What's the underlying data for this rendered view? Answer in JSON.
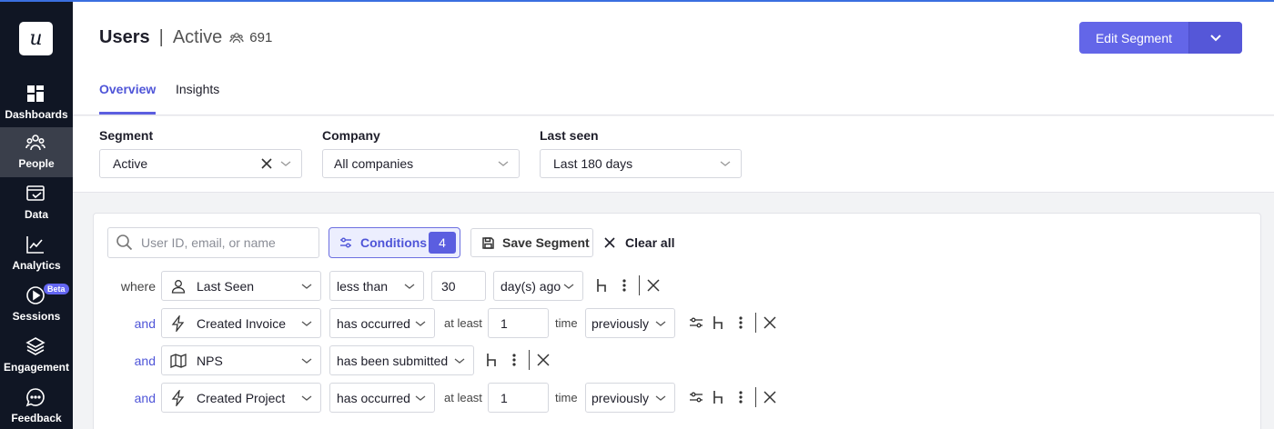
{
  "sidebar": {
    "logo": "u",
    "items": [
      {
        "label": "Dashboards",
        "icon": "dashboard-icon"
      },
      {
        "label": "People",
        "icon": "people-icon",
        "active": true
      },
      {
        "label": "Data",
        "icon": "data-icon"
      },
      {
        "label": "Analytics",
        "icon": "analytics-icon"
      },
      {
        "label": "Sessions",
        "icon": "sessions-icon",
        "badge": "Beta"
      },
      {
        "label": "Engagement",
        "icon": "engagement-icon"
      },
      {
        "label": "Feedback",
        "icon": "feedback-icon"
      }
    ]
  },
  "header": {
    "title": "Users",
    "separator": "|",
    "segment": "Active",
    "count": "691",
    "edit_button": "Edit Segment",
    "tabs": [
      {
        "label": "Overview",
        "active": true
      },
      {
        "label": "Insights",
        "active": false
      }
    ]
  },
  "filters": [
    {
      "label": "Segment",
      "value": "Active",
      "clearable": true
    },
    {
      "label": "Company",
      "value": "All companies"
    },
    {
      "label": "Last seen",
      "value": "Last 180 days"
    }
  ],
  "toolbar": {
    "search_placeholder": "User ID, email, or name",
    "conditions_label": "Conditions",
    "conditions_count": "4",
    "save_label": "Save Segment",
    "clear_label": "Clear all"
  },
  "conditions": [
    {
      "conj": "where",
      "field": "Last Seen",
      "field_icon": "user-icon",
      "operator": "less than",
      "value": "30",
      "unit": "day(s) ago"
    },
    {
      "conj": "and",
      "field": "Created Invoice",
      "field_icon": "lightning-icon",
      "operator": "has occurred",
      "mid": "at least",
      "value": "1",
      "unit_label": "time",
      "timeframe": "previously"
    },
    {
      "conj": "and",
      "field": "NPS",
      "field_icon": "map-icon",
      "operator": "has been submitted"
    },
    {
      "conj": "and",
      "field": "Created Project",
      "field_icon": "lightning-icon",
      "operator": "has occurred",
      "mid": "at least",
      "value": "1",
      "unit_label": "time",
      "timeframe": "previously"
    }
  ],
  "colors": {
    "sidebar_bg": "#101624",
    "accent": "#6366e8",
    "active_tab": "#4f55d8"
  }
}
